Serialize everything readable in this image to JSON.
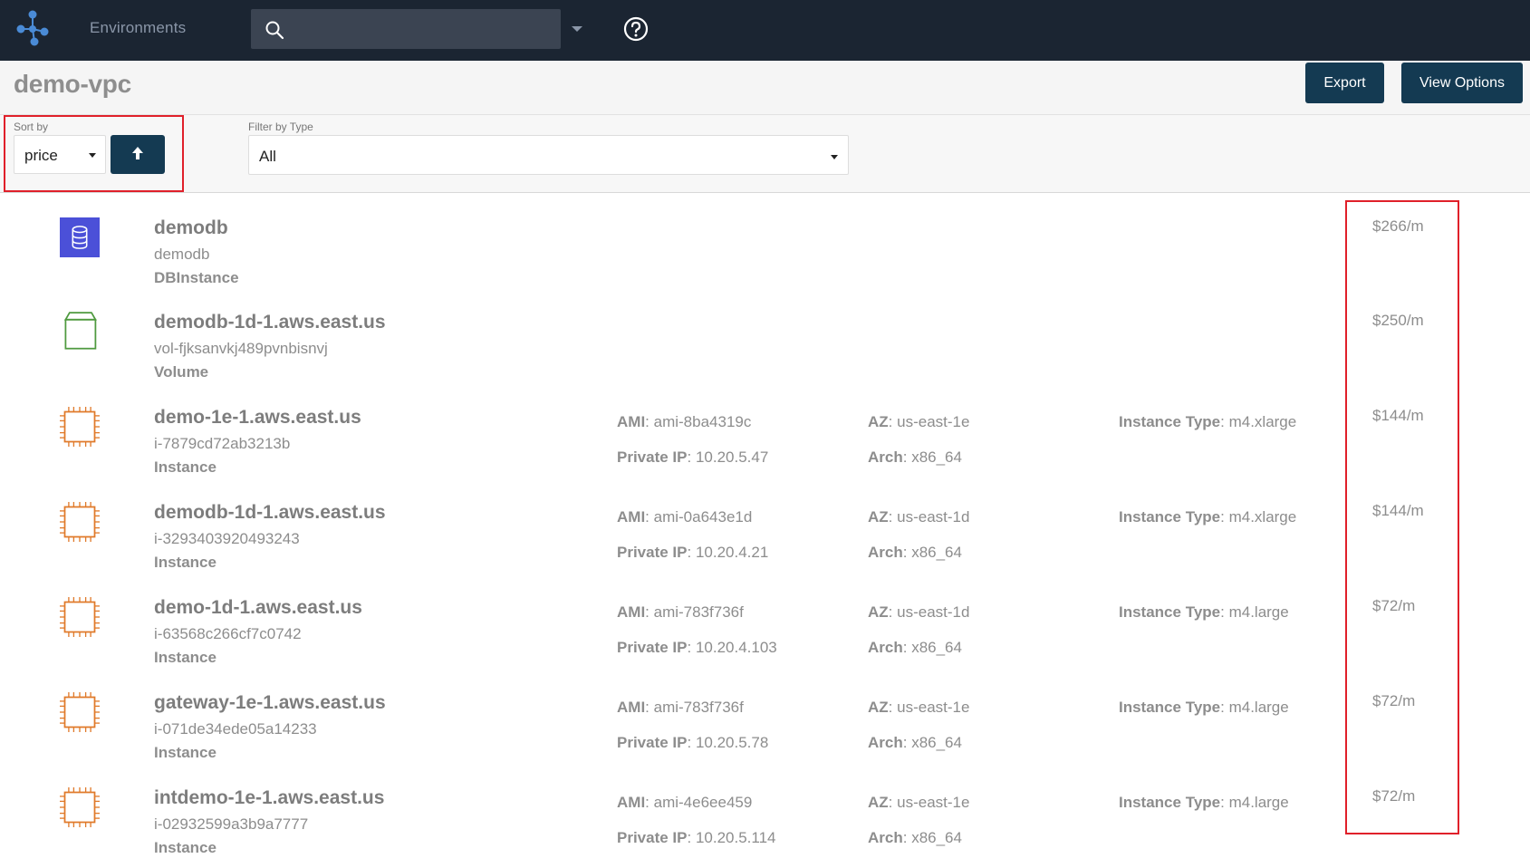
{
  "nav": {
    "section_label": "Environments",
    "search": {
      "value": "",
      "placeholder": ""
    }
  },
  "header": {
    "title": "demo-vpc",
    "export_label": "Export",
    "view_options_label": "View Options"
  },
  "sort": {
    "label": "Sort by",
    "selected": "price",
    "direction": "ascending"
  },
  "filter": {
    "label": "Filter by Type",
    "selected": "All"
  },
  "field_labels": {
    "ami": "AMI",
    "az": "AZ",
    "instance_type": "Instance Type",
    "private_ip": "Private IP",
    "arch": "Arch"
  },
  "colors": {
    "nav_bg": "#1b2532",
    "primary_button": "#143a52",
    "db_icon": "#4b50d8",
    "volume_icon": "#4f9a3f",
    "instance_icon": "#e07a2a",
    "highlight": "#e0202a"
  },
  "resources": [
    {
      "icon": "database-icon",
      "name": "demodb",
      "id": "demodb",
      "type": "DBInstance",
      "price": "$266/m"
    },
    {
      "icon": "volume-icon",
      "name": "demodb-1d-1.aws.east.us",
      "id": "vol-fjksanvkj489pvnbisnvj",
      "type": "Volume",
      "price": "$250/m"
    },
    {
      "icon": "chip-icon",
      "name": "demo-1e-1.aws.east.us",
      "id": "i-7879cd72ab3213b",
      "type": "Instance",
      "ami": "ami-8ba4319c",
      "private_ip": "10.20.5.47",
      "az": "us-east-1e",
      "arch": "x86_64",
      "instance_type": "m4.xlarge",
      "price": "$144/m"
    },
    {
      "icon": "chip-icon",
      "name": "demodb-1d-1.aws.east.us",
      "id": "i-3293403920493243",
      "type": "Instance",
      "ami": "ami-0a643e1d",
      "private_ip": "10.20.4.21",
      "az": "us-east-1d",
      "arch": "x86_64",
      "instance_type": "m4.xlarge",
      "price": "$144/m"
    },
    {
      "icon": "chip-icon",
      "name": "demo-1d-1.aws.east.us",
      "id": "i-63568c266cf7c0742",
      "type": "Instance",
      "ami": "ami-783f736f",
      "private_ip": "10.20.4.103",
      "az": "us-east-1d",
      "arch": "x86_64",
      "instance_type": "m4.large",
      "price": "$72/m"
    },
    {
      "icon": "chip-icon",
      "name": "gateway-1e-1.aws.east.us",
      "id": "i-071de34ede05a14233",
      "type": "Instance",
      "ami": "ami-783f736f",
      "private_ip": "10.20.5.78",
      "az": "us-east-1e",
      "arch": "x86_64",
      "instance_type": "m4.large",
      "price": "$72/m"
    },
    {
      "icon": "chip-icon",
      "name": "intdemo-1e-1.aws.east.us",
      "id": "i-02932599a3b9a7777",
      "type": "Instance",
      "ami": "ami-4e6ee459",
      "private_ip": "10.20.5.114",
      "az": "us-east-1e",
      "arch": "x86_64",
      "instance_type": "m4.large",
      "price": "$72/m"
    }
  ]
}
